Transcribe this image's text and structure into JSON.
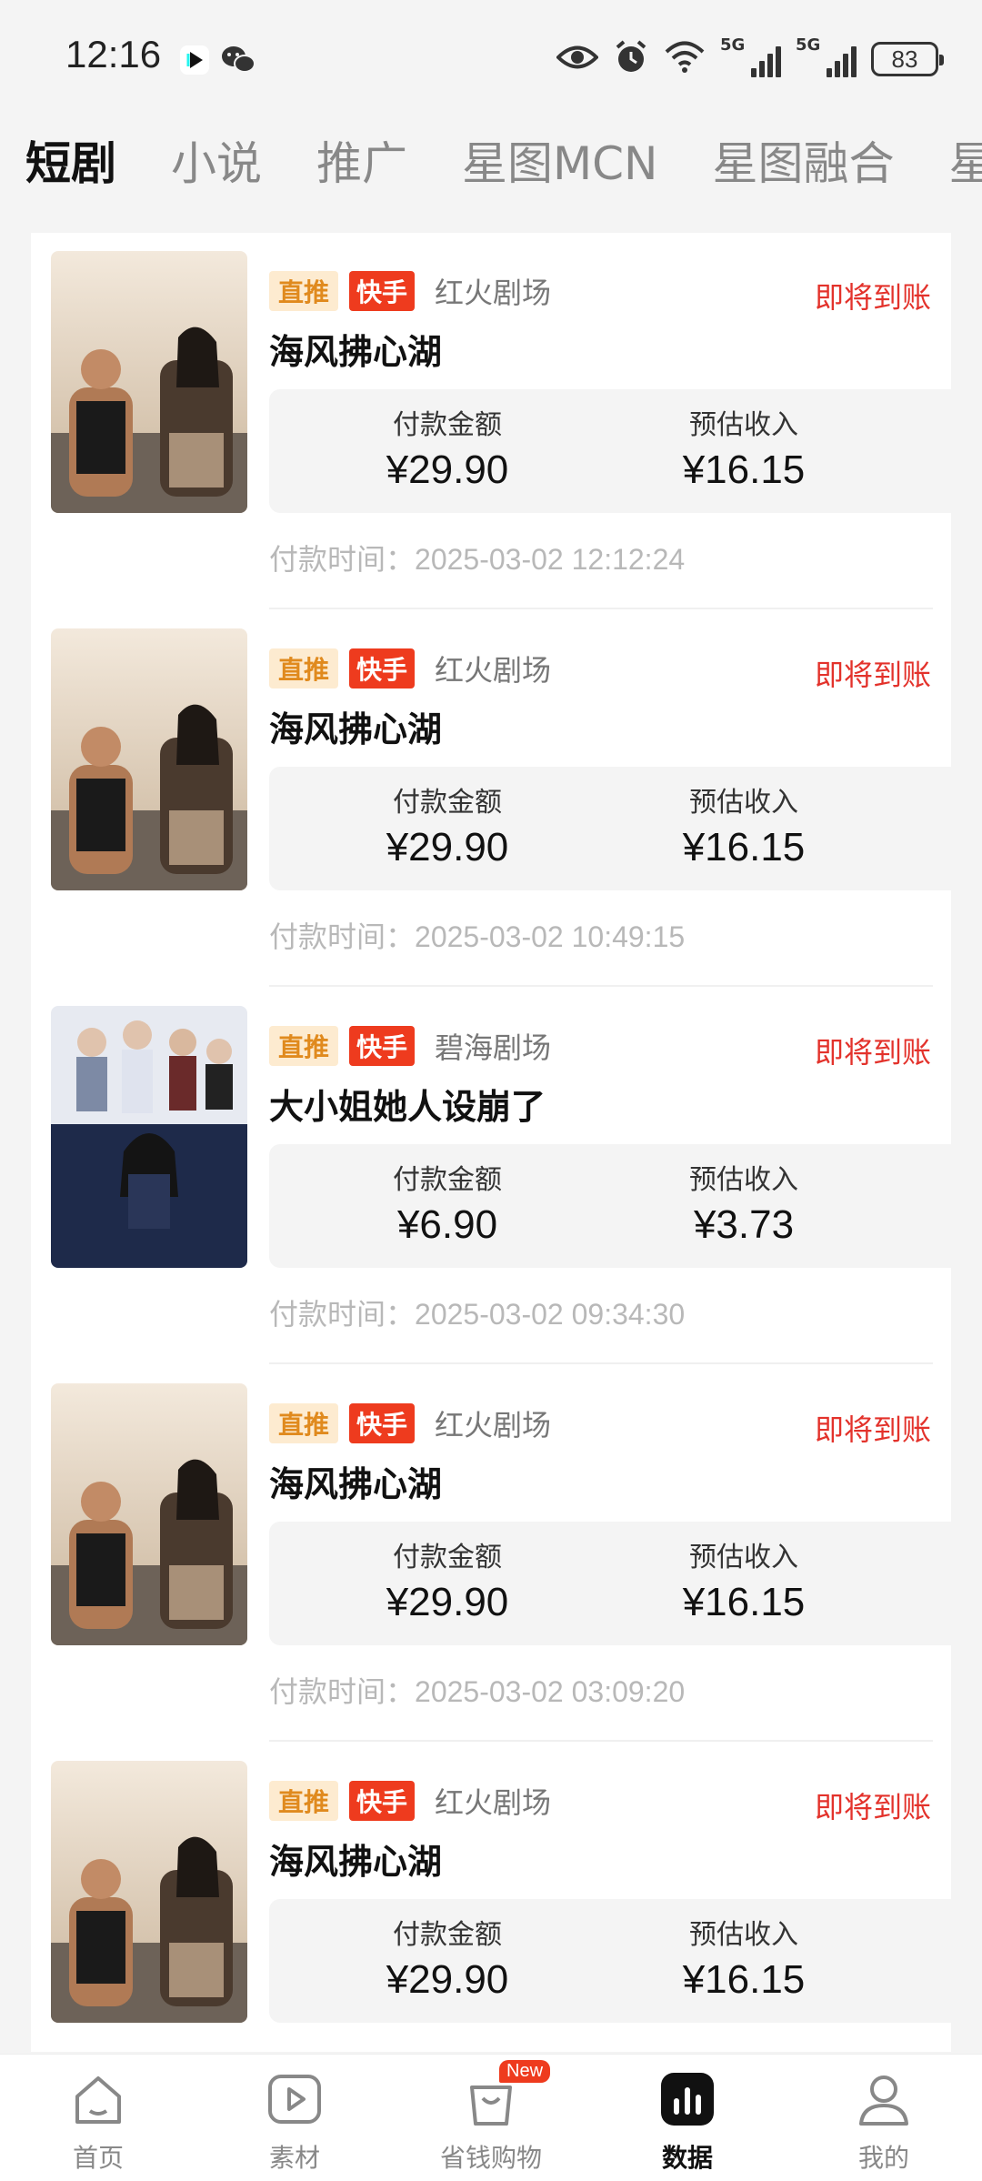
{
  "status_bar": {
    "time": "12:16",
    "battery": "83",
    "net1": "5G",
    "net2": "5G",
    "icons": [
      "douyin-icon",
      "wechat-icon",
      "eye-icon",
      "alarm-icon",
      "wifi-icon",
      "signal-icon",
      "signal-icon",
      "battery-icon"
    ]
  },
  "tabs": [
    {
      "label": "短剧",
      "active": true
    },
    {
      "label": "小说",
      "active": false
    },
    {
      "label": "推广",
      "active": false
    },
    {
      "label": "星图MCN",
      "active": false
    },
    {
      "label": "星图融合",
      "active": false
    },
    {
      "label": "星",
      "active": false
    }
  ],
  "labels": {
    "pay_amount": "付款金额",
    "est_income": "预估收入",
    "pay_time": "付款时间：",
    "badge_direct": "直推",
    "badge_platform": "快手",
    "status": "即将到账"
  },
  "colors": {
    "accent_red": "#e3322b",
    "badge_orange_bg": "#fdebd0",
    "badge_orange_text": "#e08a1e",
    "badge_red": "#ee3b1e"
  },
  "orders": [
    {
      "theatre": "红火剧场",
      "title": "海风拂心湖",
      "pay": "¥29.90",
      "income": "¥16.15",
      "time": "2025-03-02 12:12:24",
      "poster": "A"
    },
    {
      "theatre": "红火剧场",
      "title": "海风拂心湖",
      "pay": "¥29.90",
      "income": "¥16.15",
      "time": "2025-03-02 10:49:15",
      "poster": "A"
    },
    {
      "theatre": "碧海剧场",
      "title": "大小姐她人设崩了",
      "pay": "¥6.90",
      "income": "¥3.73",
      "time": "2025-03-02 09:34:30",
      "poster": "B"
    },
    {
      "theatre": "红火剧场",
      "title": "海风拂心湖",
      "pay": "¥29.90",
      "income": "¥16.15",
      "time": "2025-03-02 03:09:20",
      "poster": "A"
    },
    {
      "theatre": "红火剧场",
      "title": "海风拂心湖",
      "pay": "¥29.90",
      "income": "¥16.15",
      "time": "",
      "poster": "A"
    }
  ],
  "posters": {
    "A": {
      "text": "海风拂心湖"
    },
    "B": {
      "text": "大小姐她人设崩了"
    }
  },
  "nav": [
    {
      "label": "首页",
      "icon": "home-icon",
      "active": false
    },
    {
      "label": "素材",
      "icon": "play-icon",
      "active": false
    },
    {
      "label": "省钱购物",
      "icon": "shopping-bag-icon",
      "active": false,
      "badge": "New"
    },
    {
      "label": "数据",
      "icon": "chart-icon",
      "active": true
    },
    {
      "label": "我的",
      "icon": "profile-icon",
      "active": false
    }
  ]
}
